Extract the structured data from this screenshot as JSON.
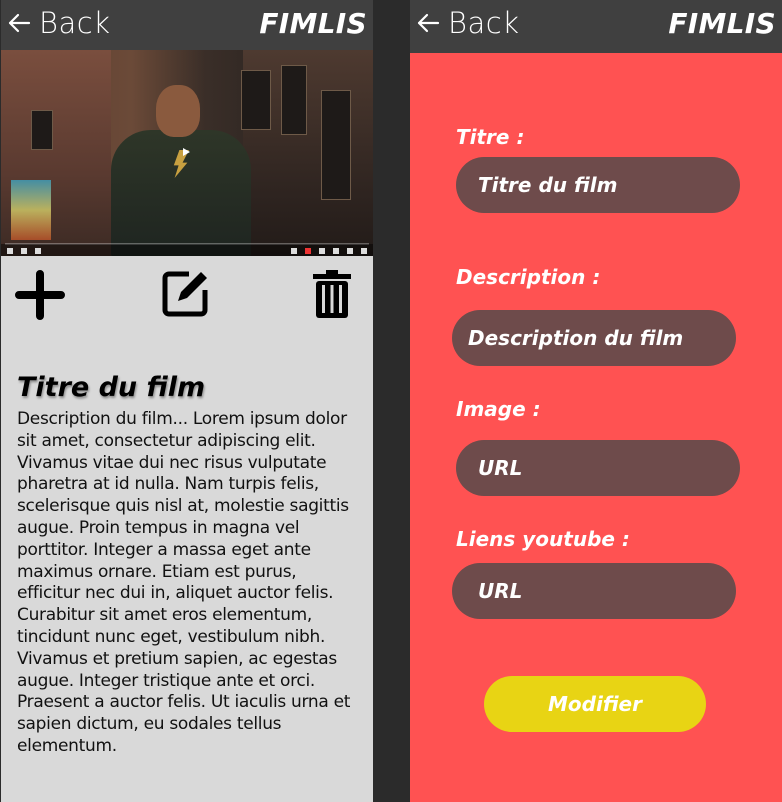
{
  "header": {
    "back_label": "Back",
    "brand": "FIMLIS"
  },
  "detail": {
    "title": "Titre du film",
    "description": "Description du film... Lorem ipsum dolor sit amet, consectetur adipiscing elit. Vivamus vitae dui nec risus vulputate pharetra at id nulla. Nam turpis felis, scelerisque quis nisl at, molestie sagittis augue. Proin tempus in magna vel porttitor. Integer a massa eget ante maximus ornare. Etiam est purus, efficitur nec dui in, aliquet auctor felis. Curabitur sit amet eros elementum, tincidunt nunc eget, vestibulum nibh. Vivamus et pretium sapien, ac egestas augue. Integer tristique ante et orci. Praesent a auctor felis. Ut iaculis urna et sapien dictum, eu sodales tellus elementum."
  },
  "actions": {
    "add_icon": "plus-icon",
    "edit_icon": "edit-icon",
    "delete_icon": "trash-icon"
  },
  "form": {
    "title_label": "Titre :",
    "title_value": "Titre du film",
    "description_label": "Description :",
    "description_value": "Description du film",
    "image_label": "Image :",
    "image_value": "URL",
    "youtube_label": "Liens youtube :",
    "youtube_value": "URL",
    "submit_label": "Modifier"
  },
  "colors": {
    "topbar": "#404040",
    "detail_bg": "#d9d9d9",
    "form_bg": "#ff5252",
    "field_bg": "#6e4b4b",
    "submit_bg": "#e8d414"
  }
}
